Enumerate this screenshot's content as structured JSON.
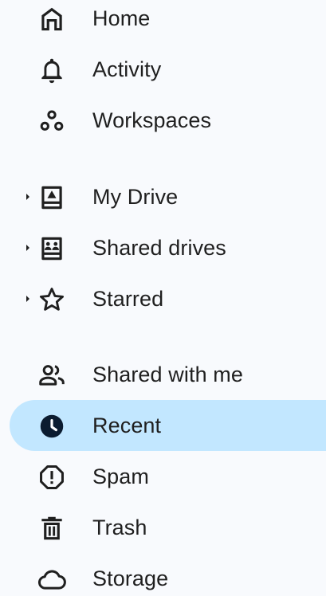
{
  "nav": {
    "items": [
      {
        "label": "Home",
        "icon": "home-icon"
      },
      {
        "label": "Activity",
        "icon": "bell-icon"
      },
      {
        "label": "Workspaces",
        "icon": "workspaces-icon"
      },
      {
        "label": "My Drive",
        "icon": "my-drive-icon",
        "expandable": true
      },
      {
        "label": "Shared drives",
        "icon": "shared-drives-icon",
        "expandable": true
      },
      {
        "label": "Starred",
        "icon": "star-icon",
        "expandable": true
      },
      {
        "label": "Shared with me",
        "icon": "people-icon"
      },
      {
        "label": "Recent",
        "icon": "clock-icon",
        "selected": true
      },
      {
        "label": "Spam",
        "icon": "spam-icon"
      },
      {
        "label": "Trash",
        "icon": "trash-icon"
      },
      {
        "label": "Storage",
        "icon": "cloud-icon"
      }
    ]
  },
  "colors": {
    "background": "#f8fafd",
    "selected_background": "#c2e7ff",
    "text": "#1f1f1f",
    "selected_icon": "#0b1c30"
  }
}
